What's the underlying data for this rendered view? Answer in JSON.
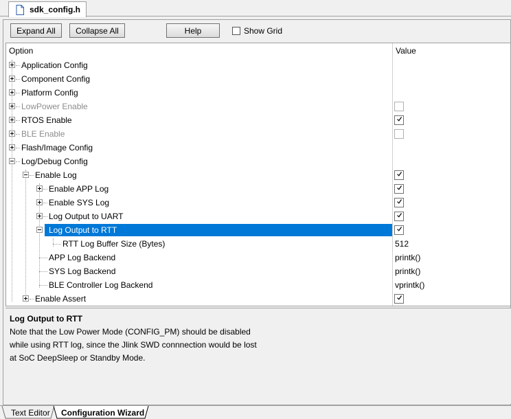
{
  "tab": {
    "title": "sdk_config.h",
    "icon": "file-icon"
  },
  "toolbar": {
    "expand_all": "Expand All",
    "collapse_all": "Collapse All",
    "help": "Help",
    "show_grid": "Show Grid"
  },
  "header": {
    "option": "Option",
    "value": "Value"
  },
  "rows": [
    {
      "label": "Application Config",
      "toggle": "plus",
      "enabled": true
    },
    {
      "label": "Component Config",
      "toggle": "plus",
      "enabled": true
    },
    {
      "label": "Platform Config",
      "toggle": "plus",
      "enabled": true
    },
    {
      "label": "LowPower Enable",
      "toggle": "plus",
      "enabled": false,
      "checked": false
    },
    {
      "label": "RTOS Enable",
      "toggle": "plus",
      "enabled": true,
      "checked": true
    },
    {
      "label": "BLE Enable",
      "toggle": "plus",
      "enabled": false,
      "checked": false
    },
    {
      "label": "Flash/Image Config",
      "toggle": "plus",
      "enabled": true
    },
    {
      "label": "Log/Debug Config",
      "toggle": "minus",
      "enabled": true
    },
    {
      "label": "Enable Log",
      "toggle": "minus",
      "enabled": true,
      "checked": true
    },
    {
      "label": "Enable APP Log",
      "toggle": "plus",
      "enabled": true,
      "checked": true
    },
    {
      "label": "Enable SYS Log",
      "toggle": "plus",
      "enabled": true,
      "checked": true
    },
    {
      "label": "Log Output to UART",
      "toggle": "plus",
      "enabled": true,
      "checked": true
    },
    {
      "label": "Log Output to RTT",
      "toggle": "minus",
      "enabled": true,
      "checked": true,
      "selected": true
    },
    {
      "label": "RTT Log Buffer Size (Bytes)",
      "value": "512"
    },
    {
      "label": "APP Log Backend",
      "value": "printk()"
    },
    {
      "label": "SYS Log Backend",
      "value": "printk()"
    },
    {
      "label": "BLE Controller Log Backend",
      "value": "vprintk()"
    },
    {
      "label": "Enable Assert",
      "toggle": "plus",
      "enabled": true,
      "checked": true
    }
  ],
  "description": {
    "title": "Log Output to RTT",
    "lines": [
      "Note that the Low Power Mode (CONFIG_PM) should be disabled",
      "while using RTT log, since the Jlink SWD connnection would be lost",
      "at SoC DeepSleep or Standby Mode."
    ]
  },
  "bottom_tabs": {
    "text_editor": "Text Editor",
    "config_wizard": "Configuration Wizard"
  }
}
